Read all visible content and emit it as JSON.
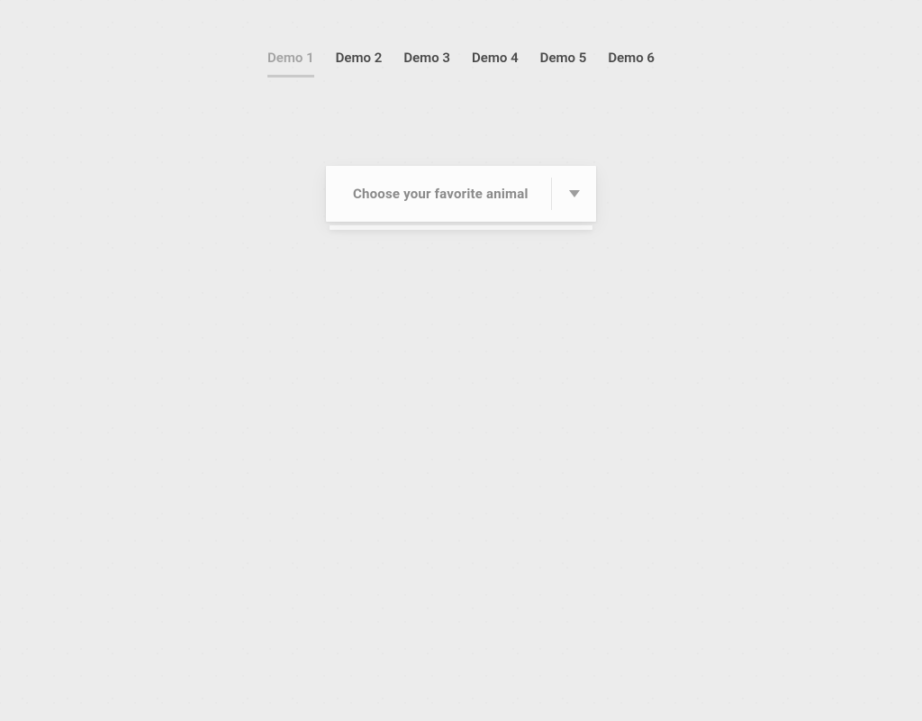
{
  "nav": {
    "items": [
      {
        "label": "Demo 1",
        "active": true
      },
      {
        "label": "Demo 2",
        "active": false
      },
      {
        "label": "Demo 3",
        "active": false
      },
      {
        "label": "Demo 4",
        "active": false
      },
      {
        "label": "Demo 5",
        "active": false
      },
      {
        "label": "Demo 6",
        "active": false
      }
    ]
  },
  "dropdown": {
    "label": "Choose your favorite animal"
  }
}
